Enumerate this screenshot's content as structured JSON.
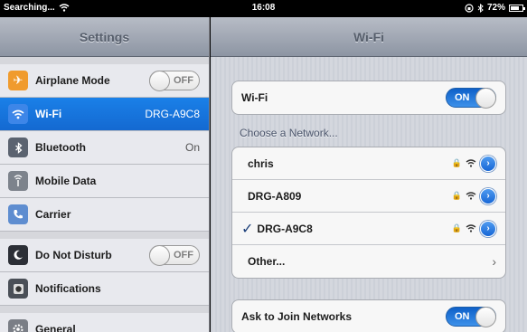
{
  "status_bar": {
    "carrier": "Searching...",
    "time": "16:08",
    "battery": "72%",
    "battery_level": 0.72
  },
  "master": {
    "title": "Settings",
    "items": [
      {
        "label": "Airplane Mode",
        "toggle": "OFF",
        "icon": "airplane-icon",
        "color": "#f09b2e"
      },
      {
        "label": "Wi-Fi",
        "value": "DRG-A9C8",
        "icon": "wifi-icon",
        "color": "#3d86e8",
        "selected": true
      },
      {
        "label": "Bluetooth",
        "value": "On",
        "icon": "bluetooth-icon",
        "color": "#5b6370"
      },
      {
        "label": "Mobile Data",
        "icon": "mobile-data-icon",
        "color": "#7d838c"
      },
      {
        "label": "Carrier",
        "icon": "phone-icon",
        "color": "#5e8dd0"
      },
      {
        "label": "Do Not Disturb",
        "toggle": "OFF",
        "icon": "moon-icon",
        "color": "#2c2f36"
      },
      {
        "label": "Notifications",
        "icon": "notifications-icon",
        "color": "#4a4f57"
      },
      {
        "label": "General",
        "icon": "gear-icon",
        "color": "#7a7e86"
      }
    ]
  },
  "detail": {
    "title": "Wi-Fi",
    "wifi_label": "Wi-Fi",
    "wifi_toggle": "ON",
    "choose_header": "Choose a Network...",
    "networks": [
      {
        "name": "chris",
        "checked": false
      },
      {
        "name": "DRG-A809",
        "checked": false
      },
      {
        "name": "DRG-A9C8",
        "checked": true
      }
    ],
    "other_label": "Other...",
    "ask_label": "Ask to Join Networks",
    "ask_toggle": "ON"
  },
  "colors": {
    "selection_blue": "#1a80e8",
    "toggle_on_blue": "#0e60c8"
  }
}
